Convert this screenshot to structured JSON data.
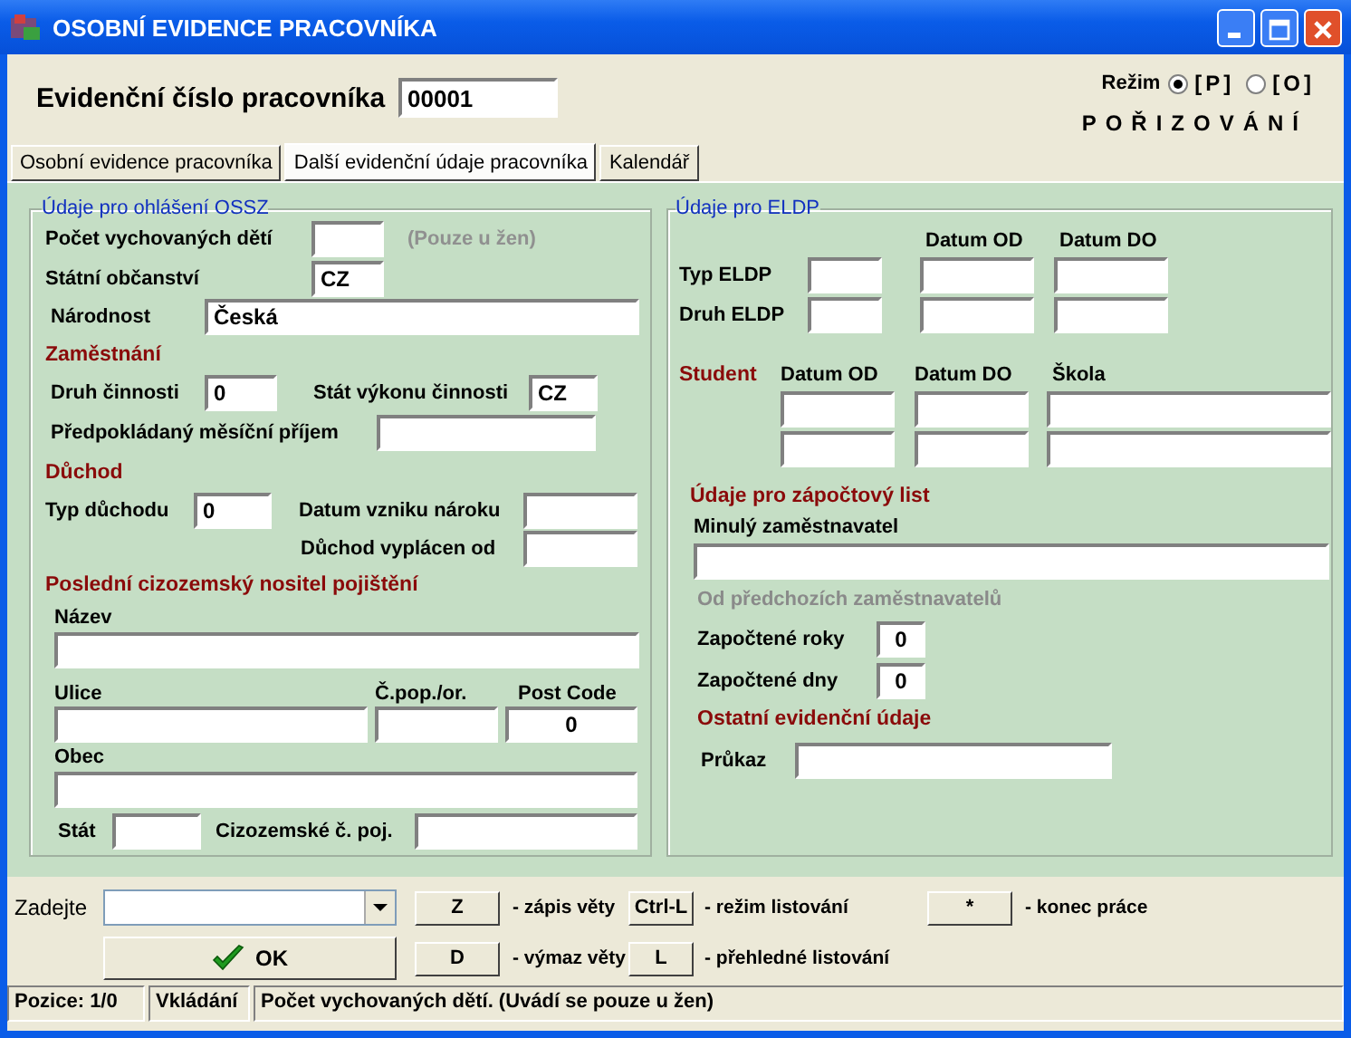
{
  "window": {
    "title": "OSOBNÍ EVIDENCE PRACOVNÍKA"
  },
  "header": {
    "label": "Evidenční číslo pracovníka",
    "value": "00001"
  },
  "mode": {
    "label": "Režim",
    "options": [
      {
        "label": "[P]",
        "selected": true
      },
      {
        "label": "[O]",
        "selected": false
      }
    ],
    "caption": "POŘIZOVÁNÍ"
  },
  "tabs": [
    {
      "label": "Osobní evidence pracovníka",
      "selected": false
    },
    {
      "label": "Další evidenční údaje pracovníka",
      "selected": true
    },
    {
      "label": "Kalendář",
      "selected": false
    }
  ],
  "ossz": {
    "legend": "Údaje pro ohlášení OSSZ",
    "children": {
      "label": "Počet vychovaných dětí",
      "note": "(Pouze u žen)"
    },
    "citizenship": {
      "label": "Státní občanství",
      "value": "CZ"
    },
    "nationality": {
      "label": "Národnost",
      "value": "Česká"
    },
    "employment": {
      "heading": "Zaměstnání",
      "activity": {
        "label": "Druh činnosti",
        "value": "0"
      },
      "state": {
        "label": "Stát výkonu činnosti",
        "value": "CZ"
      },
      "income": {
        "label": "Předpokládaný měsíční příjem"
      }
    },
    "pension": {
      "heading": "Důchod",
      "type": {
        "label": "Typ důchodu",
        "value": "0"
      },
      "claim_date": {
        "label": "Datum vzniku nároku"
      },
      "paid_from": {
        "label": "Důchod vyplácen od"
      }
    },
    "foreign_insurer": {
      "heading": "Poslední cizozemský nositel pojištění",
      "name": {
        "label": "Název"
      },
      "street": {
        "label": "Ulice"
      },
      "house_no": {
        "label": "Č.pop./or."
      },
      "post_code": {
        "label": "Post Code",
        "value": "0"
      },
      "city": {
        "label": "Obec"
      },
      "country": {
        "label": "Stát"
      },
      "insurance_no": {
        "label": "Cizozemské č. poj."
      }
    }
  },
  "eldp": {
    "legend": "Údaje pro ELDP",
    "col_from": "Datum OD",
    "col_to": "Datum DO",
    "rows": [
      {
        "label": "Typ ELDP"
      },
      {
        "label": "Druh ELDP"
      }
    ]
  },
  "student": {
    "heading": "Student",
    "columns": [
      "Datum OD",
      "Datum DO",
      "Škola"
    ]
  },
  "credit": {
    "heading": "Údaje pro zápočtový list",
    "previous_employer": {
      "label": "Minulý zaměstnavatel"
    },
    "subheading": "Od předchozích zaměstnavatelů",
    "years": {
      "label": "Započtené roky",
      "value": "0"
    },
    "days": {
      "label": "Započtené dny",
      "value": "0"
    }
  },
  "other": {
    "heading": "Ostatní evidenční údaje",
    "card": {
      "label": "Průkaz"
    }
  },
  "bottom": {
    "prompt": "Zadejte",
    "ok": "OK",
    "keys": [
      {
        "key": "Z",
        "text": "- zápis věty"
      },
      {
        "key": "Ctrl-L",
        "text": "- režim listování"
      },
      {
        "key": "*",
        "text": "- konec práce"
      },
      {
        "key": "D",
        "text": "- výmaz věty"
      },
      {
        "key": "L",
        "text": "- přehledné listování"
      }
    ]
  },
  "status": [
    "Pozice: 1/0",
    "Vkládání",
    "Počet vychovaných dětí. (Uvádí se pouze u žen)"
  ]
}
